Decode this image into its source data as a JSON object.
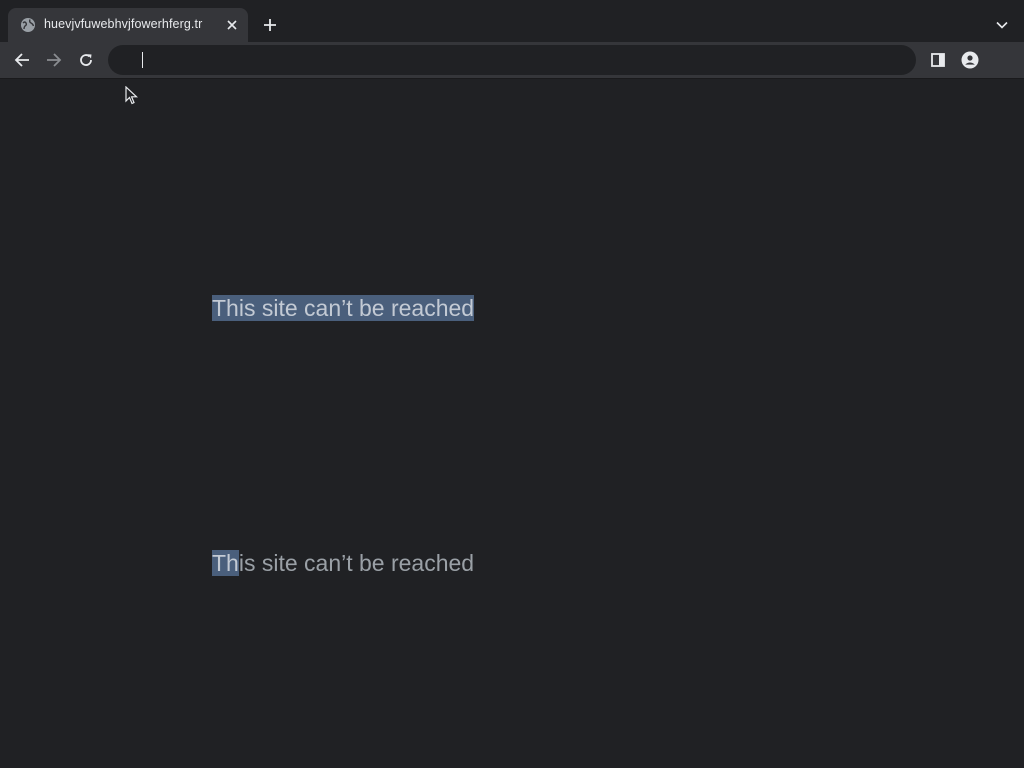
{
  "browser": {
    "tab": {
      "title": "huevjvfuwebhvjfowerhferg.tr",
      "favicon": "globe-icon",
      "close": "close-icon"
    },
    "new_tab": "plus-icon",
    "tab_search": "chevron-down-icon",
    "toolbar": {
      "back": "back-arrow-icon",
      "forward": "forward-arrow-icon",
      "reload": "reload-icon",
      "side_panel": "side-panel-icon",
      "profile": "profile-icon"
    },
    "omnibox": {
      "value": "",
      "placeholder": ""
    }
  },
  "page": {
    "heading_1": "This site can’t be reached",
    "heading_2_selected": "Th",
    "heading_2_rest": "is site can’t be reached"
  },
  "colors": {
    "background": "#202124",
    "toolbar": "#35363a",
    "text": "#9aa0a6",
    "selection": "#4a5f7c"
  }
}
